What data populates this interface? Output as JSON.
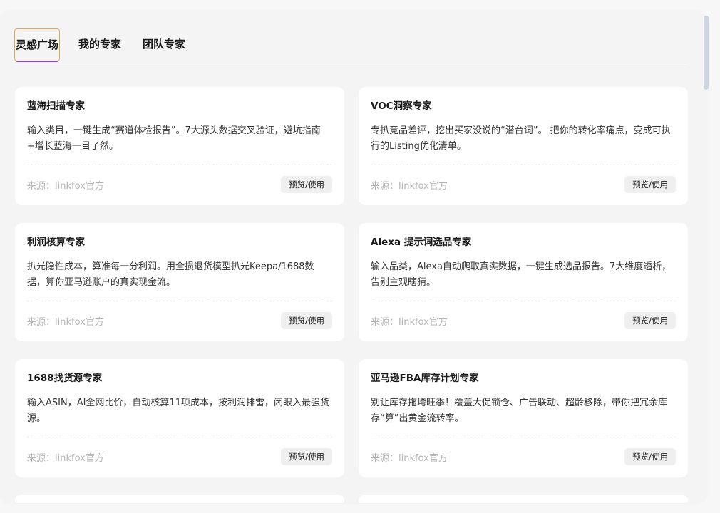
{
  "tabs": [
    {
      "label": "灵感广场",
      "active": true
    },
    {
      "label": "我的专家",
      "active": false
    },
    {
      "label": "团队专家",
      "active": false
    }
  ],
  "colors": {
    "active_tab_border": "#e8a84a",
    "active_tab_underline": "#8e44c7",
    "card_background": "#ffffff",
    "page_background": "#f4f4f4"
  },
  "cards": [
    {
      "title": "蓝海扫描专家",
      "description": "输入类目，一键生成“赛道体检报告”。7大源头数据交叉验证，避坑指南+增长蓝海一目了然。",
      "source": "来源：linkfox官方",
      "action": "预览/使用"
    },
    {
      "title": "VOC洞察专家",
      "description": "专扒竞品差评，挖出买家没说的“潜台词”。 把你的转化率痛点，变成可执行的Listing优化清单。",
      "source": "来源：linkfox官方",
      "action": "预览/使用"
    },
    {
      "title": "利润核算专家",
      "description": "扒光隐性成本，算准每一分利润。用全损退货模型扒光Keepa/1688数据，算你亚马逊账户的真实现金流。",
      "source": "来源：linkfox官方",
      "action": "预览/使用"
    },
    {
      "title": "Alexa 提示词选品专家",
      "description": "输入品类，Alexa自动爬取真实数据，一键生成选品报告。7大维度透析，告别主观瞎猜。",
      "source": "来源：linkfox官方",
      "action": "预览/使用"
    },
    {
      "title": "1688找货源专家",
      "description": "输入ASIN，AI全网比价，自动核算11项成本，按利润排雷，闭眼入最强货源。",
      "source": "来源：linkfox官方",
      "action": "预览/使用"
    },
    {
      "title": "亚马逊FBA库存计划专家",
      "description": "别让库存拖垮旺季！覆盖大促锁仓、广告联动、超龄移除，带你把冗余库存“算”出黄金流转率。",
      "source": "来源：linkfox官方",
      "action": "预览/使用"
    }
  ]
}
